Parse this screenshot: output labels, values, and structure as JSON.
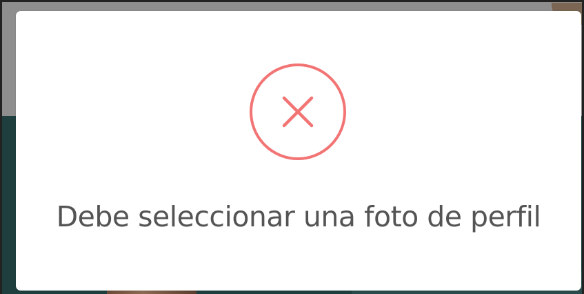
{
  "dialog": {
    "icon": "error-x-circle-icon",
    "message": "Debe seleccionar una foto de perfil"
  },
  "colors": {
    "icon_accent": "#f27474",
    "message_text": "#545454",
    "modal_background": "#ffffff",
    "backdrop_top": "#8e8e8e",
    "backdrop_bottom": "#1f3f3f"
  }
}
